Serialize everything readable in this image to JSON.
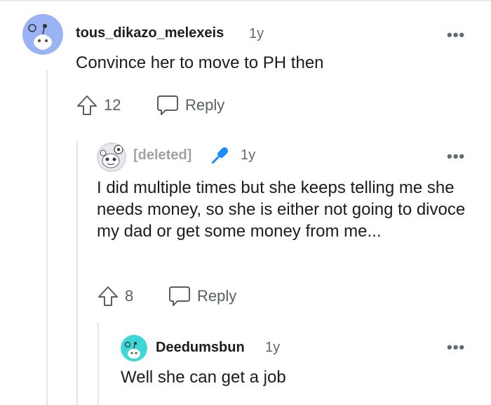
{
  "comments": [
    {
      "author": "tous_dikazo_melexeis",
      "age": "1y",
      "text": "Convince her to move to PH then",
      "votes": "12",
      "reply_label": "Reply",
      "more_label": "•••",
      "avatar_icon": "snoo-avatar-icon"
    },
    {
      "author": "[deleted]",
      "age": "1y",
      "text": "I did multiple times but she keeps telling me she needs money, so she is either not going to divoce my dad or get some money from me...",
      "votes": "8",
      "reply_label": "Reply",
      "more_label": "•••",
      "avatar_icon": "snoo-avatar-icon",
      "flair_icon": "microphone-icon"
    },
    {
      "author": "Deedumsbun",
      "age": "1y",
      "text": "Well she can get a job",
      "more_label": "•••",
      "avatar_icon": "snoo-avatar-icon"
    }
  ],
  "colors": {
    "thread_line": "#e3e5e8",
    "avatar1_bg": "#9ab3f5",
    "avatar3_bg": "#3fd6d6",
    "mic_blue": "#1a8dff",
    "muted_text": "#5f6a70"
  }
}
